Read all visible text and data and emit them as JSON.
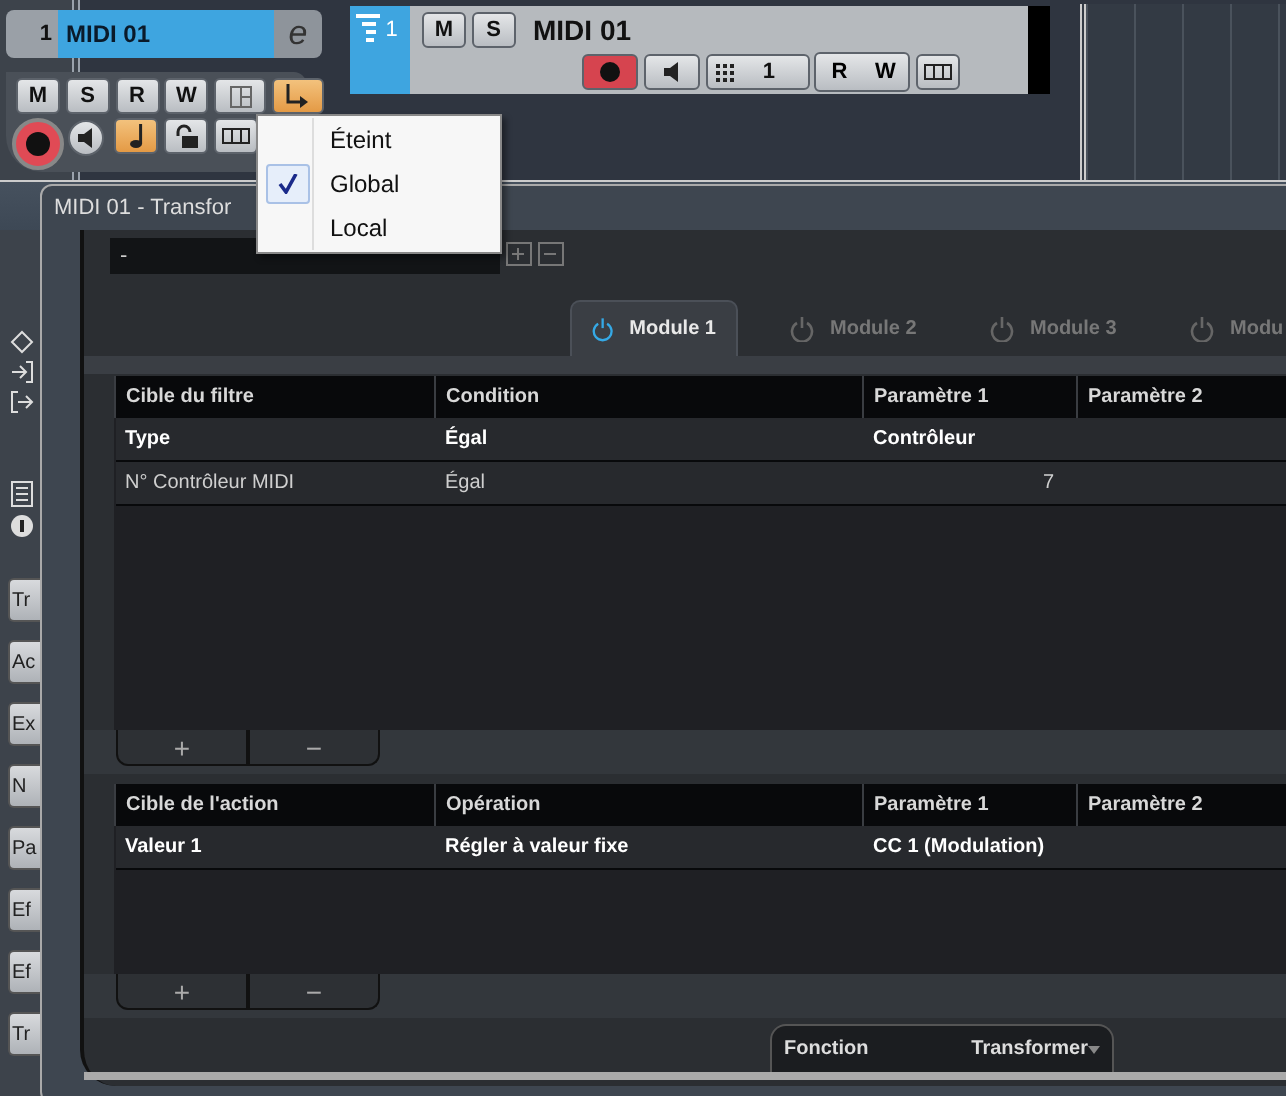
{
  "inspector": {
    "track_number": "1",
    "track_name": "MIDI 01",
    "edit_button": "e",
    "toggles": [
      {
        "kind": "text",
        "label": "M",
        "on": false
      },
      {
        "kind": "text",
        "label": "S",
        "on": false
      },
      {
        "kind": "text",
        "label": "R",
        "on": false
      },
      {
        "kind": "text",
        "label": "W",
        "on": false
      },
      {
        "kind": "icon",
        "on": false
      },
      {
        "kind": "icon",
        "on": true
      }
    ],
    "toggles_row2": [
      {
        "kind": "icon",
        "on": true
      },
      {
        "kind": "icon",
        "on": false
      },
      {
        "kind": "icon",
        "on": false
      }
    ],
    "side_tabs": [
      "Tr",
      "Ac",
      "Ex",
      "N",
      "Pa",
      "Ef",
      "Ef",
      "Tr"
    ]
  },
  "track": {
    "number": "1",
    "name": "MIDI 01",
    "buttons": [
      "M",
      "S"
    ],
    "channel": "1",
    "rw": [
      "R",
      "W"
    ]
  },
  "transformer": {
    "title": "MIDI 01 - Transfor",
    "preset": "-",
    "tabs": [
      {
        "label": "Module 1",
        "selected": true
      },
      {
        "label": "Module 2",
        "selected": false
      },
      {
        "label": "Module 3",
        "selected": false
      },
      {
        "label": "Modu",
        "selected": false
      }
    ],
    "filter": {
      "columns": [
        "Cible du filtre",
        "Condition",
        "Paramètre 1",
        "Paramètre 2"
      ],
      "rows": [
        {
          "cells": [
            "Type",
            "Égal",
            "Contrôleur"
          ],
          "selected": true
        },
        {
          "cells": [
            "N° Contrôleur MIDI",
            "Égal",
            "7"
          ],
          "selected": false
        }
      ],
      "add": "+",
      "remove": "−"
    },
    "action": {
      "columns": [
        "Cible de l'action",
        "Opération",
        "Paramètre 1",
        "Paramètre 2"
      ],
      "rows": [
        {
          "cells": [
            "Valeur 1",
            "Régler à valeur fixe",
            "CC 1  (Modulation)"
          ],
          "selected": true
        }
      ],
      "add": "+",
      "remove": "−"
    },
    "function": {
      "label": "Fonction",
      "value": "Transformer"
    }
  },
  "menu": {
    "items": [
      {
        "label": "Éteint",
        "checked": false
      },
      {
        "label": "Global",
        "checked": true
      },
      {
        "label": "Local",
        "checked": false
      }
    ]
  }
}
